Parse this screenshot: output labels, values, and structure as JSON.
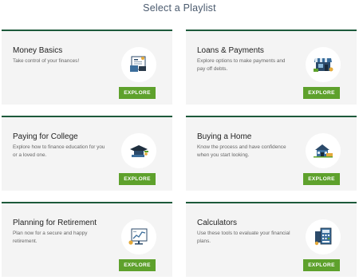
{
  "page": {
    "title": "Select a Playlist"
  },
  "cards": [
    {
      "title": "Money Basics",
      "description": "Take control of your finances!",
      "button": "EXPLORE",
      "icon": "money-basics-icon"
    },
    {
      "title": "Loans & Payments",
      "description": "Explore options to make payments and pay off debts.",
      "button": "EXPLORE",
      "icon": "storefront-icon"
    },
    {
      "title": "Paying for College",
      "description": "Explore how to finance education for you or a loved one.",
      "button": "EXPLORE",
      "icon": "graduation-cap-icon"
    },
    {
      "title": "Buying a Home",
      "description": "Know the process and have confidence when you start looking.",
      "button": "EXPLORE",
      "icon": "house-icon"
    },
    {
      "title": "Planning for Retirement",
      "description": "Plan now for a secure and happy retirement.",
      "button": "EXPLORE",
      "icon": "retirement-chart-icon"
    },
    {
      "title": "Calculators",
      "description": "Use these tools to evaluate your financial plans.",
      "button": "EXPLORE",
      "icon": "calculator-icon"
    }
  ],
  "colors": {
    "accent_green": "#5ea12c",
    "top_border": "#1d5a3b",
    "card_bg": "#f4f4f4",
    "title": "#4a5a6e"
  }
}
